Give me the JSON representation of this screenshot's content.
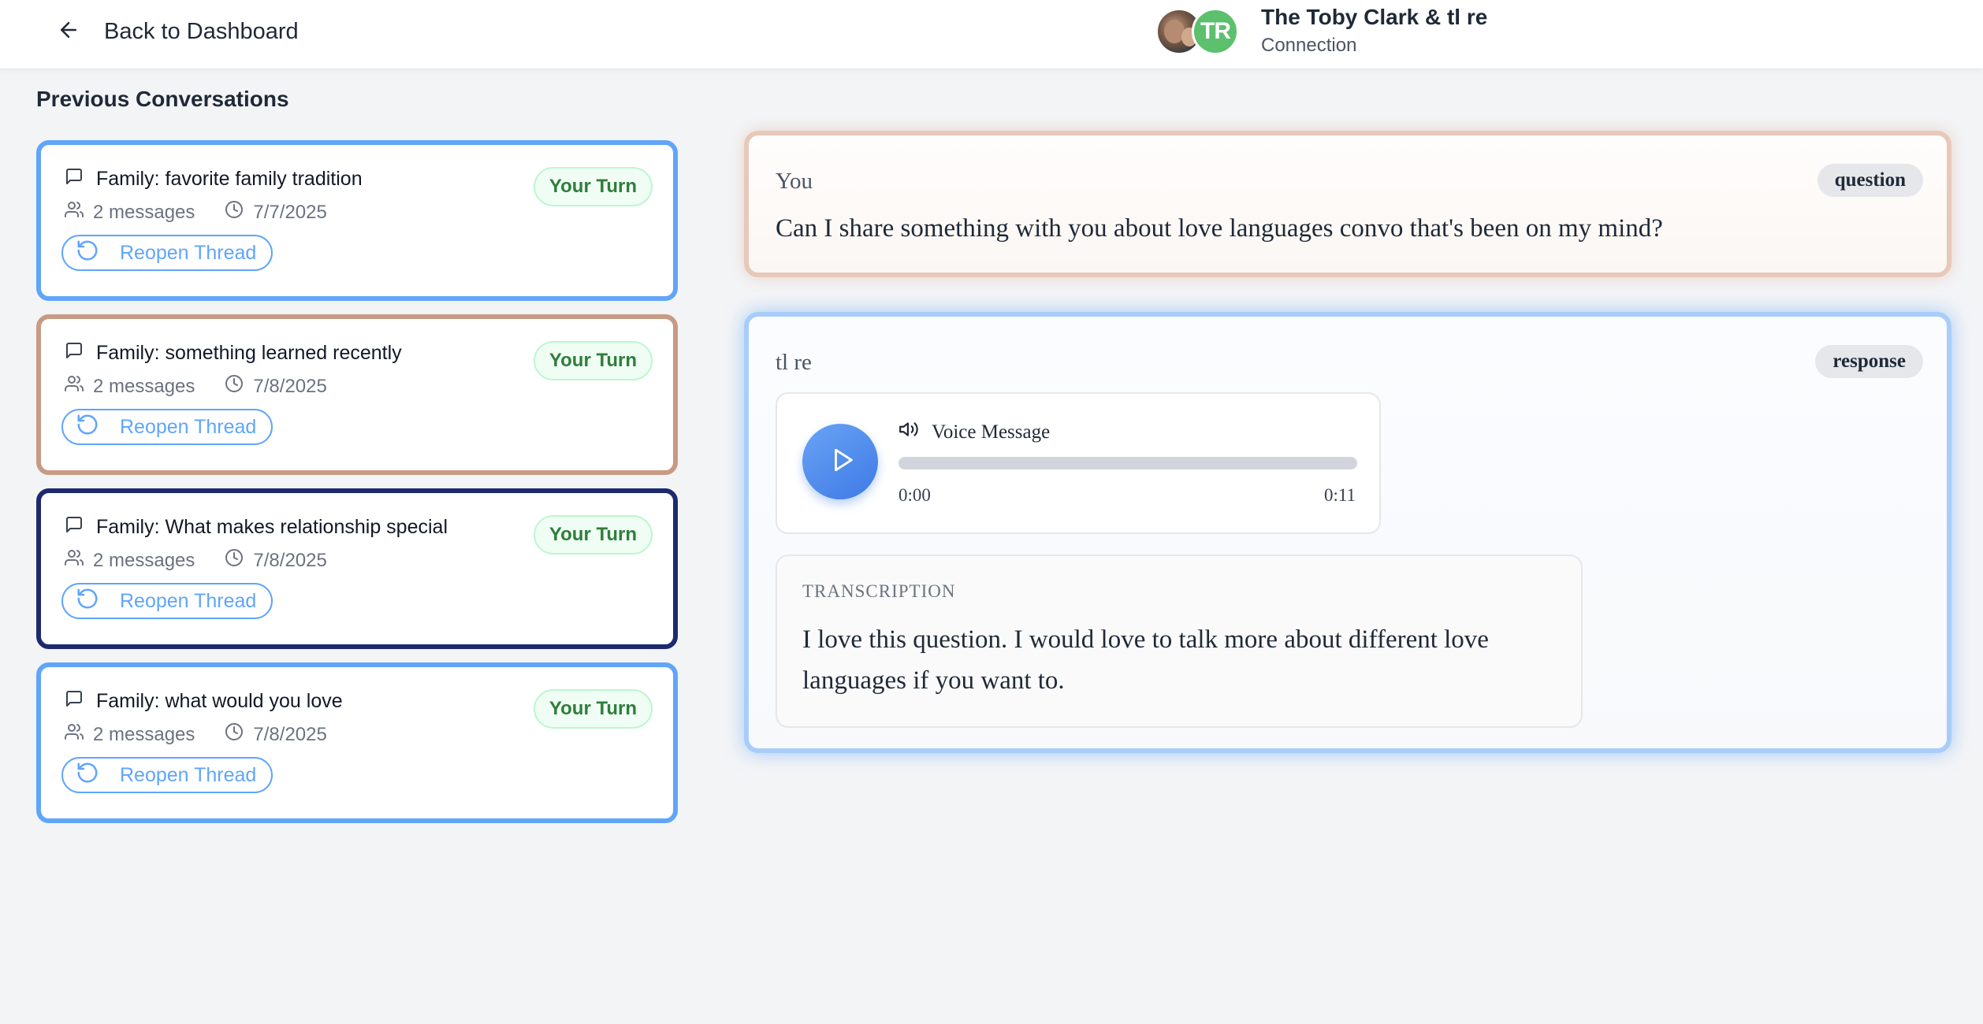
{
  "header": {
    "back_label": "Back to Dashboard",
    "avatar_initials": "TR",
    "title": "The Toby Clark & tl re",
    "subtitle": "Connection"
  },
  "sidebar": {
    "title": "Previous Conversations",
    "cards": [
      {
        "title": "Family: favorite family tradition",
        "messages": "2 messages",
        "date": "7/7/2025",
        "badge": "Your Turn",
        "action": "Reopen Thread",
        "border_color": "#60a5fa"
      },
      {
        "title": "Family: something learned recently",
        "messages": "2 messages",
        "date": "7/8/2025",
        "badge": "Your Turn",
        "action": "Reopen Thread",
        "border_color": "#c89a85"
      },
      {
        "title": "Family: What makes relationship special",
        "messages": "2 messages",
        "date": "7/8/2025",
        "badge": "Your Turn",
        "action": "Reopen Thread",
        "border_color": "#1e2a6e"
      },
      {
        "title": "Family: what would you love",
        "messages": "2 messages",
        "date": "7/8/2025",
        "badge": "Your Turn",
        "action": "Reopen Thread",
        "border_color": "#60a5fa"
      }
    ]
  },
  "main": {
    "question": {
      "sender": "You",
      "tag": "question",
      "text": "Can I share something with you about love languages convo that's been on my mind?"
    },
    "response": {
      "sender": "tl re",
      "tag": "response",
      "voice": {
        "label": "Voice Message",
        "current_time": "0:00",
        "duration": "0:11",
        "progress": 0
      },
      "transcription_label": "TRANSCRIPTION",
      "transcription_text": "I love this question. I would love to talk more about different love languages if you want to."
    }
  },
  "colors": {
    "accent_blue": "#60a5fa",
    "badge_green": "#2f7d3b",
    "avatar_green": "#5cc06d",
    "question_border": "#e8c8b8",
    "response_border": "#a9cdfa"
  },
  "icons": [
    "arrow-left-icon",
    "message-square-icon",
    "users-icon",
    "clock-icon",
    "rotate-ccw-icon",
    "play-icon",
    "volume-icon"
  ]
}
